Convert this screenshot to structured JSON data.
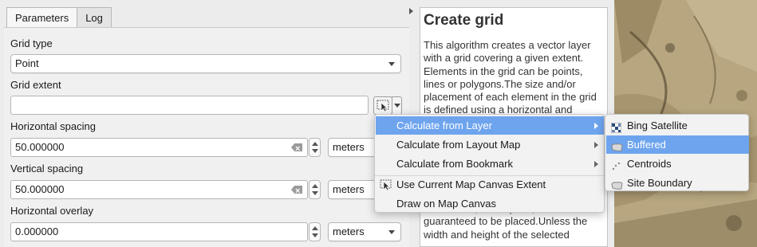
{
  "tabs": [
    {
      "label": "Parameters",
      "active": true
    },
    {
      "label": "Log",
      "active": false
    }
  ],
  "form": {
    "grid_type_label": "Grid type",
    "grid_type_value": "Point",
    "grid_extent_label": "Grid extent",
    "grid_extent_value": "",
    "h_spacing_label": "Horizontal spacing",
    "h_spacing_value": "50.000000",
    "h_spacing_unit": "meters",
    "v_spacing_label": "Vertical spacing",
    "v_spacing_value": "50.000000",
    "v_spacing_unit": "meters",
    "h_overlay_label": "Horizontal overlay",
    "h_overlay_value": "0.000000",
    "h_overlay_unit": "meters"
  },
  "help": {
    "title": "Create grid",
    "body": "This algorithm creates a vector layer with a grid covering a given extent. Elements in the grid can be points, lines or polygons.The size and/or placement of each element in the grid is defined using a horizontal and",
    "tail": "means that,at that point,an element is guaranteed to be placed.Unless the width and height of the selected"
  },
  "menu": {
    "items": [
      {
        "label": "Calculate from Layer",
        "submenu": true,
        "highlighted": true,
        "icon": ""
      },
      {
        "label": "Calculate from Layout Map",
        "submenu": true,
        "highlighted": false,
        "icon": ""
      },
      {
        "label": "Calculate from Bookmark",
        "submenu": true,
        "highlighted": false,
        "icon": ""
      },
      {
        "label": "Use Current Map Canvas Extent",
        "submenu": false,
        "highlighted": false,
        "icon": "map-canvas-extent-icon"
      },
      {
        "label": "Draw on Map Canvas",
        "submenu": false,
        "highlighted": false,
        "icon": ""
      }
    ]
  },
  "submenu": {
    "items": [
      {
        "label": "Bing Satellite",
        "highlighted": false,
        "icon": "raster-layer-icon"
      },
      {
        "label": "Buffered",
        "highlighted": true,
        "icon": "polygon-layer-icon"
      },
      {
        "label": "Centroids",
        "highlighted": false,
        "icon": "point-layer-icon"
      },
      {
        "label": "Site Boundary",
        "highlighted": false,
        "icon": "polygon-layer-icon"
      }
    ]
  },
  "colors": {
    "highlight": "#6ea4ee",
    "panel_bg": "#f0f0f0"
  }
}
